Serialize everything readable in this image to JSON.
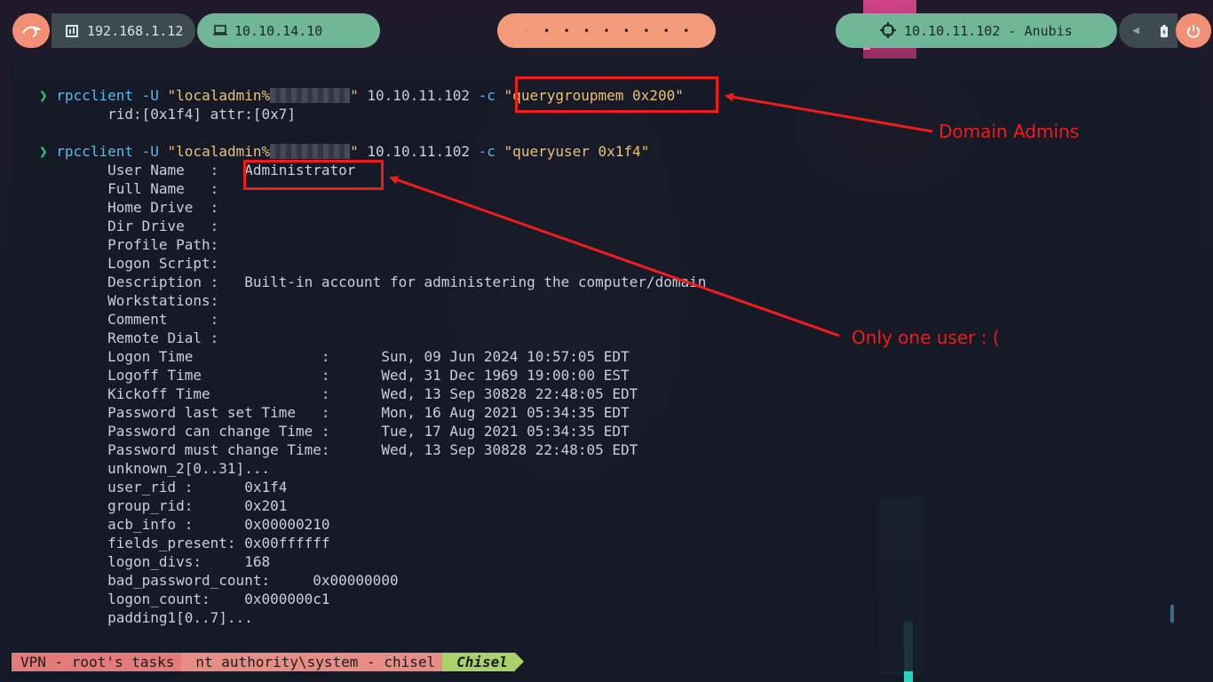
{
  "topbar": {
    "logo_icon": "kali-dragon-icon",
    "local_ip": "192.168.1.12",
    "vpn_ip": "10.10.14.10",
    "workspaces": [
      "•",
      "•",
      "•",
      "•",
      "•",
      "•",
      "•",
      "•",
      "•"
    ],
    "active_workspace": 1,
    "target": "10.10.11.102 - Anubis",
    "target_icon": "crosshair-icon",
    "audio_icon": "speaker-muted-icon",
    "battery_icon": "battery-icon",
    "power_icon": "power-icon"
  },
  "terminal": {
    "prompt_symbol": "❯",
    "cmd1": {
      "program": "rpcclient",
      "flag_u": "-U",
      "user_prefix": "\"localadmin%",
      "user_suffix": "\"",
      "host": "10.10.11.102",
      "flag_c": "-c",
      "command": "\"querygroupmem 0x200\""
    },
    "cmd1_output": "        rid:[0x1f4] attr:[0x7]",
    "cmd2": {
      "program": "rpcclient",
      "flag_u": "-U",
      "user_prefix": "\"localadmin%",
      "user_suffix": "\"",
      "host": "10.10.11.102",
      "flag_c": "-c",
      "command": "\"queryuser 0x1f4\""
    },
    "cmd2_output": [
      "        User Name   :   Administrator",
      "        Full Name   :",
      "        Home Drive  :",
      "        Dir Drive   :",
      "        Profile Path:",
      "        Logon Script:",
      "        Description :   Built-in account for administering the computer/domain",
      "        Workstations:",
      "        Comment     :",
      "        Remote Dial :",
      "        Logon Time               :      Sun, 09 Jun 2024 10:57:05 EDT",
      "        Logoff Time              :      Wed, 31 Dec 1969 19:00:00 EST",
      "        Kickoff Time             :      Wed, 13 Sep 30828 22:48:05 EDT",
      "        Password last set Time   :      Mon, 16 Aug 2021 05:34:35 EDT",
      "        Password can change Time :      Tue, 17 Aug 2021 05:34:35 EDT",
      "        Password must change Time:      Wed, 13 Sep 30828 22:48:05 EDT",
      "        unknown_2[0..31]...",
      "        user_rid :      0x1f4",
      "        group_rid:      0x201",
      "        acb_info :      0x00000210",
      "        fields_present: 0x00ffffff",
      "        logon_divs:     168",
      "        bad_password_count:     0x00000000",
      "        logon_count:    0x000000c1",
      "        padding1[0..7]..."
    ]
  },
  "annotations": {
    "domain_admins": "Domain Admins",
    "only_one_user": "Only one user : (",
    "color": "#ee1c1c"
  },
  "tabs": [
    {
      "label": "VPN - root's tasks"
    },
    {
      "label": "nt authority\\system - chisel"
    },
    {
      "label": "Chisel"
    }
  ]
}
